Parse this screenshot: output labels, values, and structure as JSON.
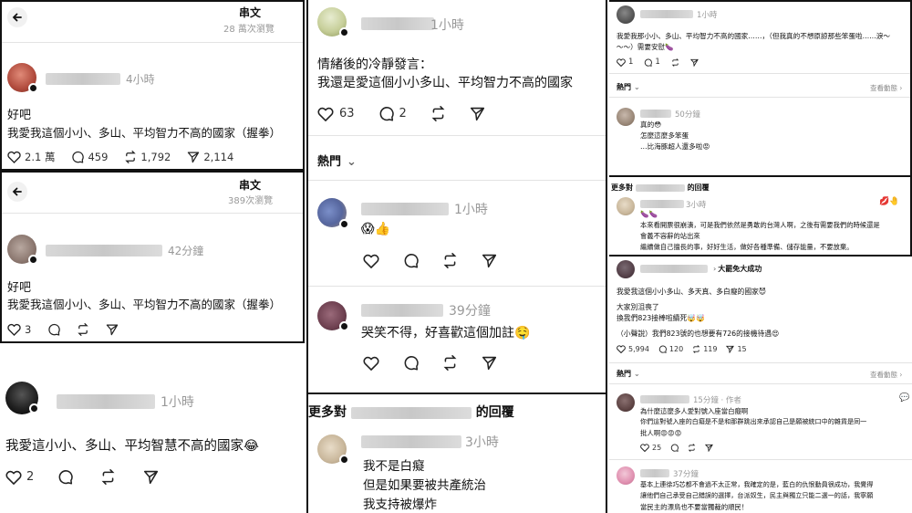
{
  "panel1": {
    "header_title": "串文",
    "header_views": "28 萬次瀏覽",
    "time": "4小時",
    "line1": "好吧",
    "line2": "我愛我這個小小、多山、平均智力不高的國家（握拳）",
    "likes": "2.1 萬",
    "comments": "459",
    "reposts": "1,792",
    "shares": "2,114"
  },
  "panel2": {
    "header_title": "串文",
    "header_views": "389次瀏覽",
    "time": "42分鐘",
    "line1": "好吧",
    "line2": "我愛我這個小小、多山、平均智力不高的國家（握拳）",
    "likes": "3"
  },
  "panel3": {
    "time": "1小時",
    "text": "我愛這小小、多山、平均智慧不高的國家😂",
    "likes": "2"
  },
  "panel4": {
    "time": "1小時",
    "line1": "情緒後的冷靜發言：",
    "line2": "我還是愛這個小小多山、平均智力不高的國家",
    "likes": "63",
    "comments": "2",
    "sort_label": "熱門",
    "reply1_time": "1小時",
    "reply1_text": "😱👍",
    "reply2_time": "39分鐘",
    "reply2_text": "哭笑不得，好喜歡這個加註🤤",
    "more_replies_prefix": "更多對",
    "more_replies_suffix": "的回覆",
    "reply3_time": "3小時",
    "reply3_line1": "我不是白癡",
    "reply3_line2": "但是如果要被共產統治",
    "reply3_line3": "我支持被爆炸"
  },
  "panel5": {
    "time": "1小時",
    "line1": "我愛我那小小、多山、平均智力不高的國家……，（但我真的不想原諒那些笨蛋啦……淚～",
    "line2": "～～）需要安慰🍆",
    "likes": "1",
    "comments": "1",
    "sort_label": "熱門",
    "view_activity": "查看動態",
    "reply1_time": "50分鐘",
    "reply1_l1": "真的😳",
    "reply1_l2": "怎麼這麼多笨蛋",
    "reply1_l3": "…比海豚超人還多啦😡",
    "more_replies_prefix": "更多對",
    "more_replies_suffix": "的回覆",
    "reply2_time": "3小時",
    "reply2_l0": "🍆🍆",
    "reply2_l1": "本來看開票很崩潰，可是我們依然是勇敢的台灣人啊，之後有需要我們的時候還是",
    "reply2_l2": "會義不容辭的站出來",
    "reply2_l3": "繼續做自己擅長的事，好好生活，做好各種準備、儲存能量，不要放棄。",
    "reply2_reaction": "💋🤚"
  },
  "panel6": {
    "tag": "大罷免大成功",
    "line1": "我愛我這個小小多山、多天真、多白癡的國家😈",
    "line2": "大家別沮喪了",
    "line3": "換我們823接棒啦續死🤯🤯",
    "line4": "（小聲說）我們823號的也想要有726的接機待遇😍",
    "likes": "5,994",
    "comments": "120",
    "reposts": "119",
    "shares": "15",
    "sort_label": "熱門",
    "view_activity": "查看動態",
    "reply1_time": "15分鐘 · 作者",
    "reply1_l1": "為什麼這麼多人愛對號入座當白癡啊",
    "reply1_l2": "你們這對號入座的白癡是不是和那群跳出來承認自己是願被統口中的雜貨是同一",
    "reply1_l3": "批人啊😡😡😡",
    "reply1_likes": "25",
    "reply2_time": "37分鐘",
    "reply2_l1": "基本上連徐巧芯都不會過不太正常，我確定的是，藍白的仇恨動員很成功，我覺得",
    "reply2_l2": "讓他們自己承受自己錯誤的選擇，台派奴生，民主與獨立只能二選一的話，我寧願",
    "reply2_l3": "當民主的漂鳥也不要當獨裁的順民！"
  }
}
